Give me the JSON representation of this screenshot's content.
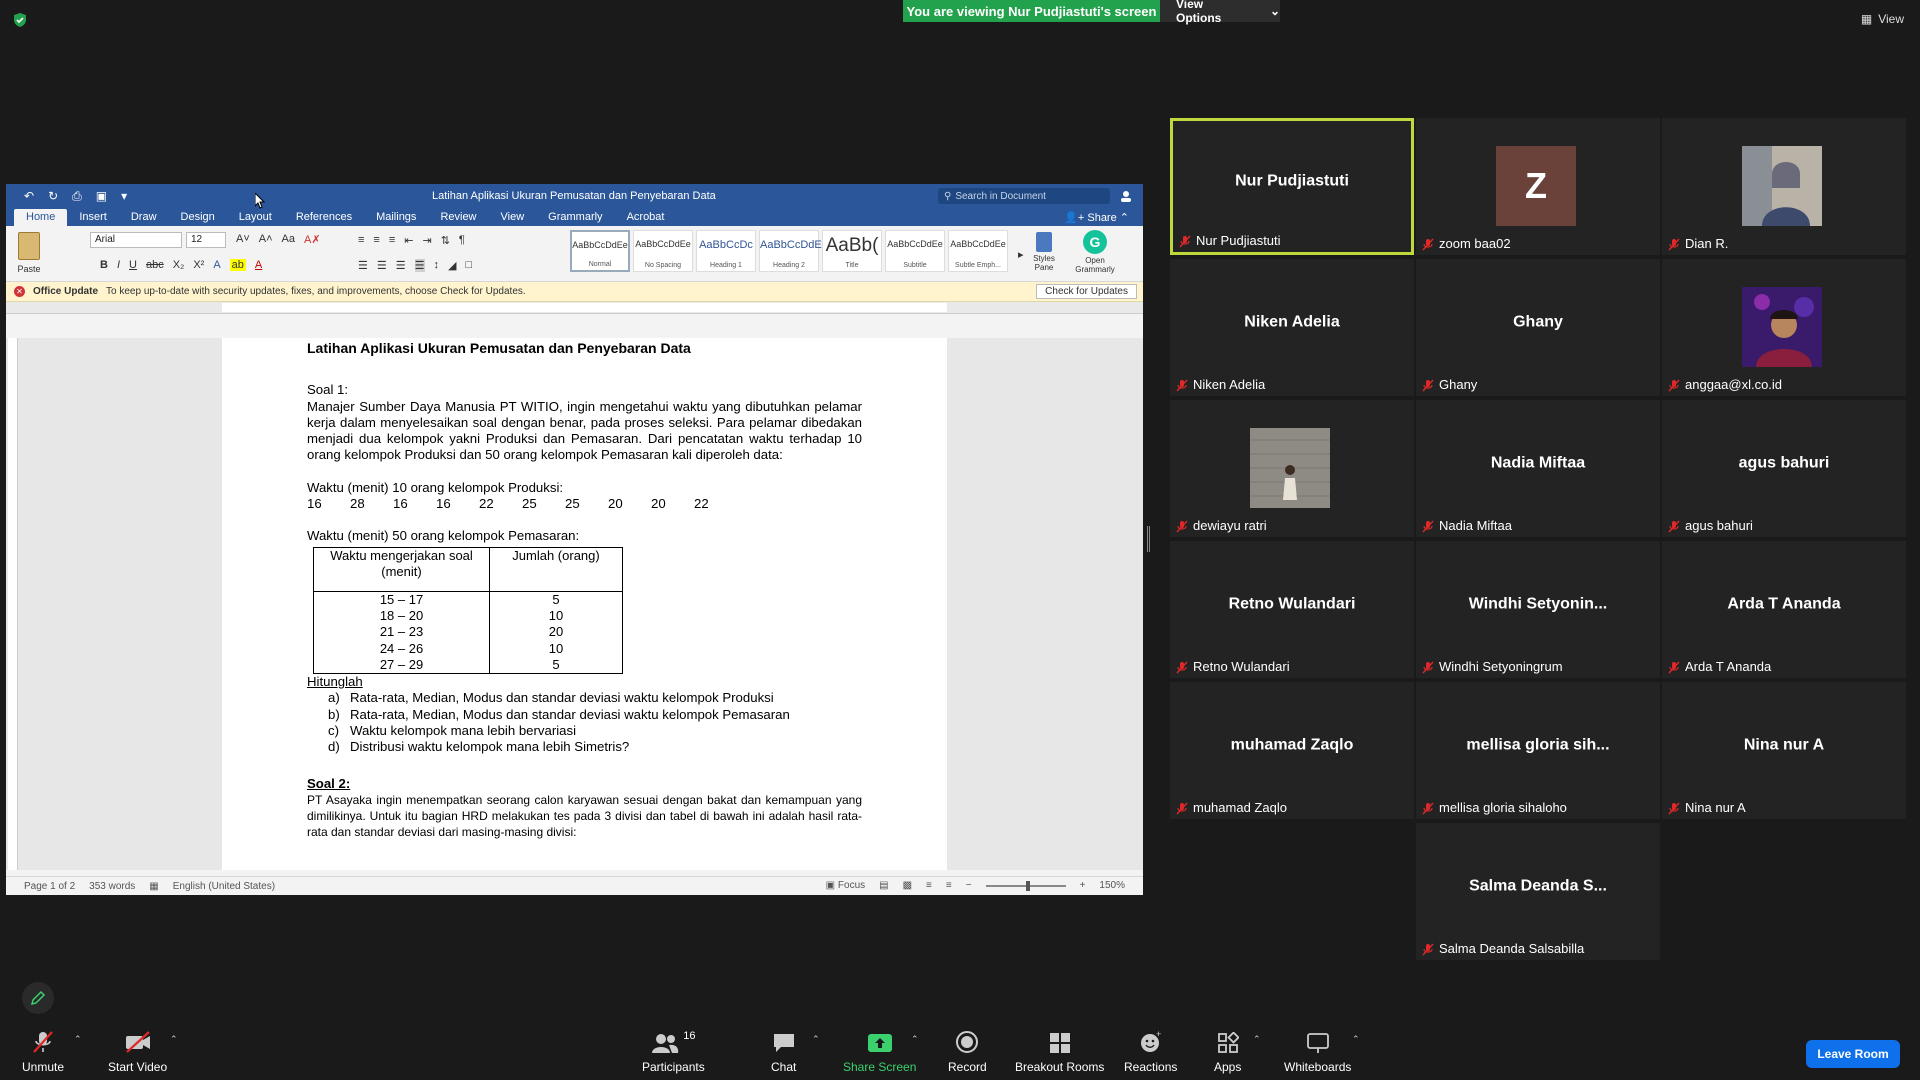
{
  "banner": {
    "viewing_text": "You are viewing Nur Pudjiastuti's screen",
    "view_options": "View Options",
    "view": "View"
  },
  "word": {
    "title": "Latihan Aplikasi Ukuran Pemusatan dan Penyebaran Data",
    "search_placeholder": "Search in Document",
    "tabs": [
      "Home",
      "Insert",
      "Draw",
      "Design",
      "Layout",
      "References",
      "Mailings",
      "Review",
      "View",
      "Grammarly",
      "Acrobat"
    ],
    "share": "Share",
    "paste": "Paste",
    "font": "Arial",
    "size": "12",
    "styles": [
      {
        "preview": "AaBbCcDdEe",
        "name": "Normal"
      },
      {
        "preview": "AaBbCcDdEe",
        "name": "No Spacing"
      },
      {
        "preview": "AaBbCcDc",
        "name": "Heading 1"
      },
      {
        "preview": "AaBbCcDdEe",
        "name": "Heading 2"
      },
      {
        "preview": "AaBb(",
        "name": "Title"
      },
      {
        "preview": "AaBbCcDdEe",
        "name": "Subtitle"
      },
      {
        "preview": "AaBbCcDdEe",
        "name": "Subtle Emph..."
      }
    ],
    "styles_pane": "Styles Pane",
    "open_grammarly": "Open Grammarly",
    "update_label": "Office Update",
    "update_text": "To keep up-to-date with security updates, fixes, and improvements, choose Check for Updates.",
    "check_updates": "Check for Updates",
    "status": {
      "page": "Page 1 of 2",
      "words": "353 words",
      "lang": "English (United States)",
      "focus": "Focus",
      "zoom": "150%"
    }
  },
  "doc": {
    "heading": "Latihan Aplikasi Ukuran Pemusatan dan Penyebaran Data",
    "soal1": "Soal 1:",
    "para1": "Manajer Sumber Daya Manusia PT WITIO, ingin mengetahui waktu yang dibutuhkan pelamar kerja dalam menyelesaikan soal dengan benar,  pada proses seleksi.  Para pelamar dibedakan menjadi dua kelompok yakni  Produksi dan Pemasaran. Dari pencatatan waktu terhadap 10 orang kelompok Produksi dan 50 orang kelompok Pemasaran  kali diperoleh data:",
    "prod_label": "Waktu (menit) 10 orang kelompok Produksi:",
    "prod_values": [
      "16",
      "28",
      "16",
      "16",
      "22",
      "25",
      "25",
      "20",
      "20",
      "22"
    ],
    "pem_label": "Waktu (menit) 50 orang kelompok Pemasaran:",
    "table_headers": [
      "Waktu mengerjakan soal (menit)",
      "Jumlah (orang)"
    ],
    "table_rows": [
      [
        "15 – 17",
        "5"
      ],
      [
        "18 – 20",
        "10"
      ],
      [
        "21 – 23",
        "20"
      ],
      [
        "24 – 26",
        "10"
      ],
      [
        "27 – 29",
        "5"
      ]
    ],
    "hitunglah": "Hitunglah",
    "questions": [
      {
        "l": "a)",
        "t": "Rata-rata, Median, Modus dan standar deviasi waktu kelompok Produksi"
      },
      {
        "l": "b)",
        "t": "Rata-rata, Median, Modus dan standar deviasi waktu kelompok Pemasaran"
      },
      {
        "l": "c)",
        "t": "Waktu kelompok mana lebih bervariasi"
      },
      {
        "l": "d)",
        "t": "Distribusi waktu kelompok mana lebih Simetris?"
      }
    ],
    "soal2": "Soal 2:",
    "para2": "PT Asayaka ingin menempatkan seorang calon karyawan sesuai dengan bakat dan kemampuan yang dimilikinya. Untuk itu bagian HRD melakukan tes pada 3 divisi dan tabel di bawah ini adalah hasil rata-rata dan standar deviasi dari masing-masing divisi:"
  },
  "participants": [
    {
      "center": "Nur Pudjiastuti",
      "footer": "Nur Pudjiastuti",
      "active": true
    },
    {
      "center": "",
      "footer": "zoom baa02",
      "avatar": "Z"
    },
    {
      "center": "",
      "footer": "Dian R.",
      "photo": "dian"
    },
    {
      "center": "Niken Adelia",
      "footer": "Niken Adelia"
    },
    {
      "center": "Ghany",
      "footer": "Ghany"
    },
    {
      "center": "",
      "footer": "anggaa@xl.co.id",
      "photo": "angga"
    },
    {
      "center": "",
      "footer": "dewiayu ratri",
      "photo": "dewi"
    },
    {
      "center": "Nadia Miftaa",
      "footer": "Nadia Miftaa"
    },
    {
      "center": "agus bahuri",
      "footer": "agus bahuri"
    },
    {
      "center": "Retno Wulandari",
      "footer": "Retno Wulandari"
    },
    {
      "center": "Windhi  Setyonin...",
      "footer": "Windhi Setyoningrum"
    },
    {
      "center": "Arda T Ananda",
      "footer": "Arda T Ananda"
    },
    {
      "center": "muhamad Zaqlo",
      "footer": "muhamad Zaqlo"
    },
    {
      "center": "mellisa  gloria  sih...",
      "footer": "mellisa gloria sihaloho"
    },
    {
      "center": "Nina nur A",
      "footer": "Nina nur A"
    },
    {
      "center": "Salma  Deanda  S...",
      "footer": "Salma Deanda Salsabilla"
    }
  ],
  "toolbar": {
    "unmute": "Unmute",
    "start_video": "Start Video",
    "participants": "Participants",
    "participants_count": "16",
    "chat": "Chat",
    "share_screen": "Share Screen",
    "record": "Record",
    "breakout": "Breakout Rooms",
    "reactions": "Reactions",
    "apps": "Apps",
    "whiteboards": "Whiteboards",
    "leave": "Leave Room"
  }
}
